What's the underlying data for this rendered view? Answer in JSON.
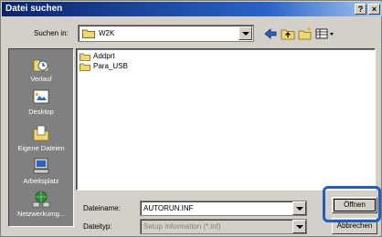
{
  "window": {
    "title": "Datei suchen",
    "help_button": "?",
    "close_button": "×"
  },
  "lookin": {
    "label": "Suchen in:",
    "value": "W2K"
  },
  "toolbar": {
    "icons": [
      "back-icon",
      "up-folder-icon",
      "new-folder-icon",
      "view-menu-icon"
    ]
  },
  "places": [
    {
      "label": "Verlauf",
      "icon": "history-icon"
    },
    {
      "label": "Desktop",
      "icon": "desktop-icon"
    },
    {
      "label": "Eigene Dateien",
      "icon": "my-documents-icon"
    },
    {
      "label": "Arbeitsplatz",
      "icon": "my-computer-icon"
    },
    {
      "label": "Netzwerkumg...",
      "icon": "network-icon"
    }
  ],
  "files": [
    {
      "name": "Addprt",
      "icon": "folder-icon"
    },
    {
      "name": "Para_USB",
      "icon": "folder-icon"
    }
  ],
  "filename": {
    "label": "Dateiname:",
    "value": "AUTORUN.INF"
  },
  "filetype": {
    "label": "Dateityp:",
    "value": "Setup Information (*.inf)"
  },
  "buttons": {
    "open": "Öffnen",
    "cancel": "Abbrechen"
  },
  "colors": {
    "title_bar": "#0a246a",
    "highlight": "#1e5ec8",
    "window_bg": "#d4d0c8",
    "folder": "#f5d66a"
  }
}
